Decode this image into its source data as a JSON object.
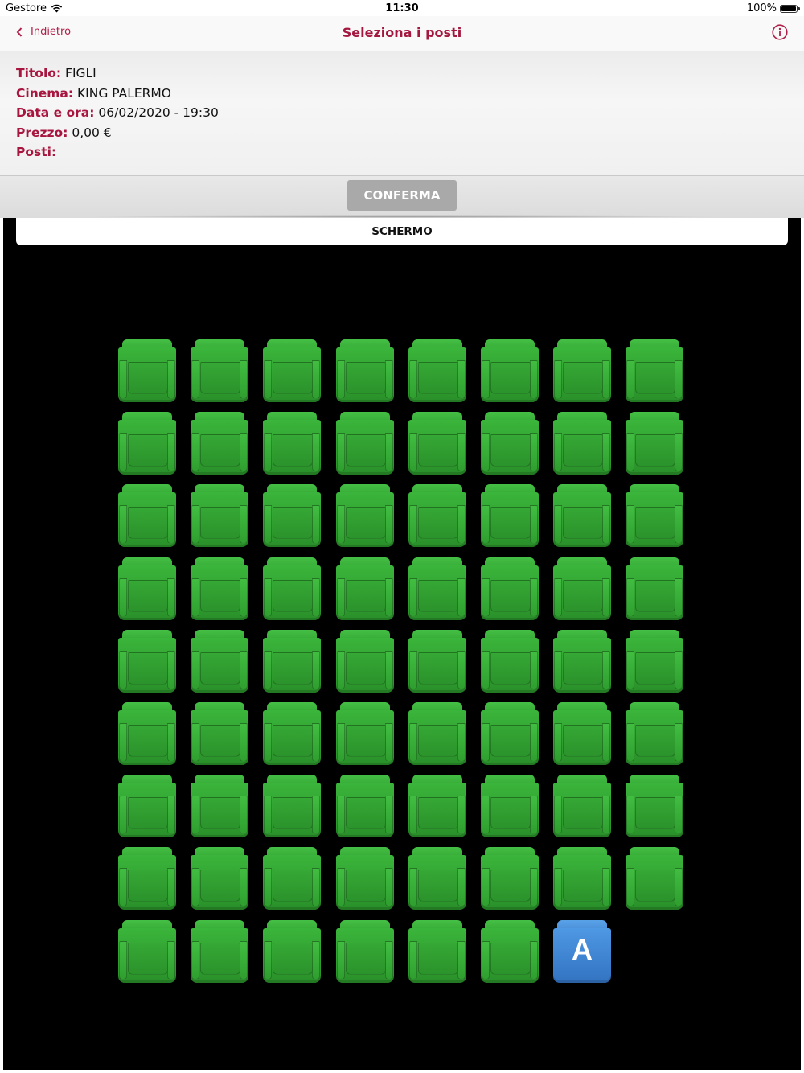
{
  "status_bar": {
    "carrier": "Gestore",
    "time": "11:30",
    "battery": "100%",
    "battery_level": 1.0
  },
  "nav": {
    "back_label": "Indietro",
    "title": "Seleziona i posti",
    "info_icon": "info-circle-icon"
  },
  "info": {
    "title_label": "Titolo:",
    "title_value": "FIGLI",
    "cinema_label": "Cinema:",
    "cinema_value": "KING PALERMO",
    "datetime_label": "Data e ora:",
    "datetime_value": "06/02/2020 - 19:30",
    "price_label": "Prezzo:",
    "price_value": "0,00 €",
    "seats_label": "Posti:",
    "seats_value": ""
  },
  "confirm": {
    "label": "CONFERMA"
  },
  "seat_map": {
    "screen_label": "SCHERMO",
    "colors": {
      "available": "#2e9f2e",
      "special": "#4a90e2",
      "background": "#000000"
    },
    "rows": [
      [
        "available",
        "available",
        "available",
        "available",
        "available",
        "available",
        "available",
        "available"
      ],
      [
        "available",
        "available",
        "available",
        "available",
        "available",
        "available",
        "available",
        "available"
      ],
      [
        "available",
        "available",
        "available",
        "available",
        "available",
        "available",
        "available",
        "available"
      ],
      [
        "available",
        "available",
        "available",
        "available",
        "available",
        "available",
        "available",
        "available"
      ],
      [
        "available",
        "available",
        "available",
        "available",
        "available",
        "available",
        "available",
        "available"
      ],
      [
        "available",
        "available",
        "available",
        "available",
        "available",
        "available",
        "available",
        "available"
      ],
      [
        "available",
        "available",
        "available",
        "available",
        "available",
        "available",
        "available",
        "available"
      ],
      [
        "available",
        "available",
        "available",
        "available",
        "available",
        "available",
        "available",
        "available"
      ],
      [
        "available",
        "available",
        "available",
        "available",
        "available",
        "available",
        "special",
        "empty"
      ]
    ],
    "special_seat_letter": "A"
  }
}
